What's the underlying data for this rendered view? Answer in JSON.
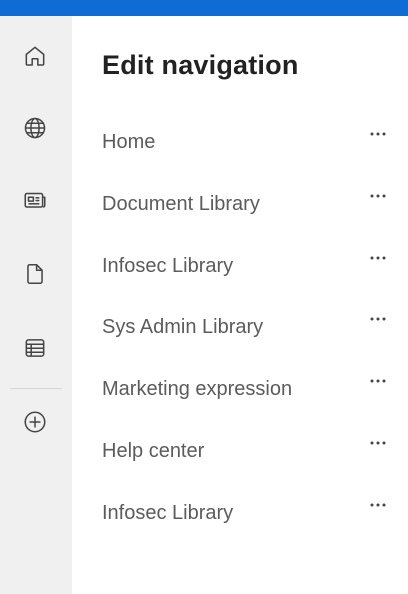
{
  "rail": {
    "items": [
      {
        "icon": "home-icon"
      },
      {
        "icon": "globe-icon"
      },
      {
        "icon": "news-icon"
      },
      {
        "icon": "document-icon"
      },
      {
        "icon": "list-icon"
      },
      {
        "icon": "add-circle-icon"
      }
    ]
  },
  "panel": {
    "title": "Edit navigation",
    "items": [
      {
        "label": "Home"
      },
      {
        "label": "Document Library"
      },
      {
        "label": "Infosec Library"
      },
      {
        "label": "Sys Admin Library"
      },
      {
        "label": "Marketing expression"
      },
      {
        "label": "Help center"
      },
      {
        "label": "Infosec Library"
      }
    ]
  },
  "colors": {
    "accent": "#0f6cd4",
    "rail_background": "#f0f0f0",
    "label_text": "#5b5b5b",
    "title_text": "#222222"
  }
}
